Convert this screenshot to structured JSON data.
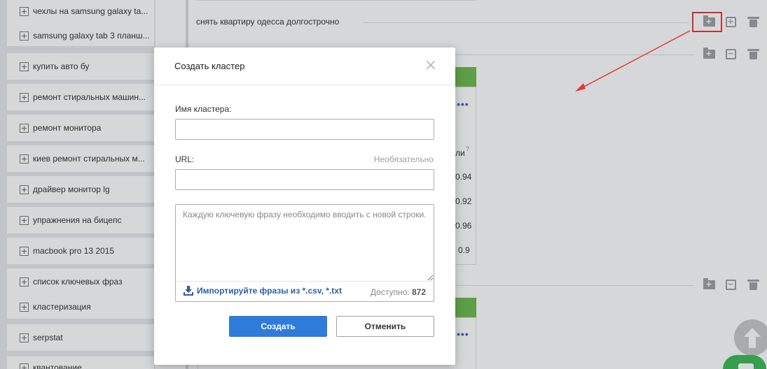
{
  "sidebar": {
    "items": [
      {
        "label": "чехлы на samsung galaxy ta..."
      },
      {
        "label": "samsung galaxy tab 3 планш..."
      },
      {
        "label": "купить авто бу"
      },
      {
        "label": "ремонт стиральных машин..."
      },
      {
        "label": "ремонт монитора"
      },
      {
        "label": "киев ремонт стиральных м..."
      },
      {
        "label": "драйвер монитор lg"
      },
      {
        "label": "упражнения на бицепс"
      },
      {
        "label": "macbook pro 13 2015"
      },
      {
        "label": "список ключевых фраз"
      },
      {
        "label": "кластеризация"
      },
      {
        "label": "serpstat"
      },
      {
        "label": "квантование"
      }
    ],
    "plus_glyph": "+"
  },
  "main": {
    "cluster_title": "снять квартиру одесса долгострочно",
    "icons": {
      "add_folder": "folder-plus-icon",
      "add": "plus-square-icon",
      "collapse": "minus-square-icon",
      "delete": "trash-icon"
    },
    "table_values": [
      "0.94",
      "0.92",
      "0.96",
      "0.9"
    ],
    "column_header_fragment": "ли",
    "help_mark": "?",
    "dots": "•••"
  },
  "modal": {
    "title": "Создать кластер",
    "close_glyph": "×",
    "name_label": "Имя кластера:",
    "name_value": "",
    "url_label": "URL:",
    "url_optional": "Необязательно",
    "url_value": "",
    "phrases_placeholder": "Каждую ключевую фразу необходимо вводить с новой строки.",
    "import_label": "Импортируйте фразы из *.csv, *.txt",
    "available_label": "Доступно:",
    "available_count": "872",
    "create_label": "Создать",
    "cancel_label": "Отменить"
  },
  "colors": {
    "accent_blue": "#2f7bd9",
    "green_header": "#6cba4f",
    "highlight_red": "#e0393c",
    "chat_green": "#3dba5a"
  }
}
